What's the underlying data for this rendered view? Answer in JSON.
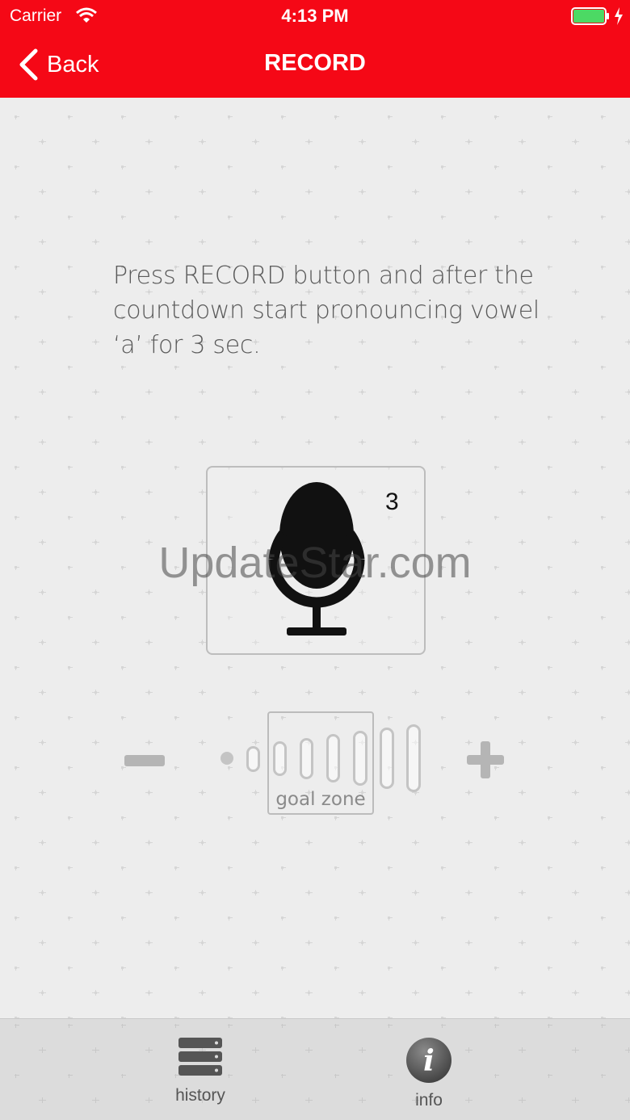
{
  "status_bar": {
    "carrier": "Carrier",
    "time": "4:13 PM",
    "battery_color": "#4cd964"
  },
  "nav": {
    "back_label": "Back",
    "title": "RECORD",
    "background_color": "#f50816"
  },
  "content": {
    "instruction": "Press RECORD button and after the countdown start pronouncing vowel ‘a’ for 3 sec.",
    "countdown": "3",
    "watermark": "UpdateStar.com",
    "record_icon": "microphone-icon",
    "minus_icon": "minus-icon",
    "plus_icon": "plus-icon",
    "goal_zone_label": "goal zone"
  },
  "tab_bar": {
    "items": [
      {
        "label": "history",
        "icon": "server-stack-icon"
      },
      {
        "label": "info",
        "icon": "info-icon"
      }
    ]
  }
}
